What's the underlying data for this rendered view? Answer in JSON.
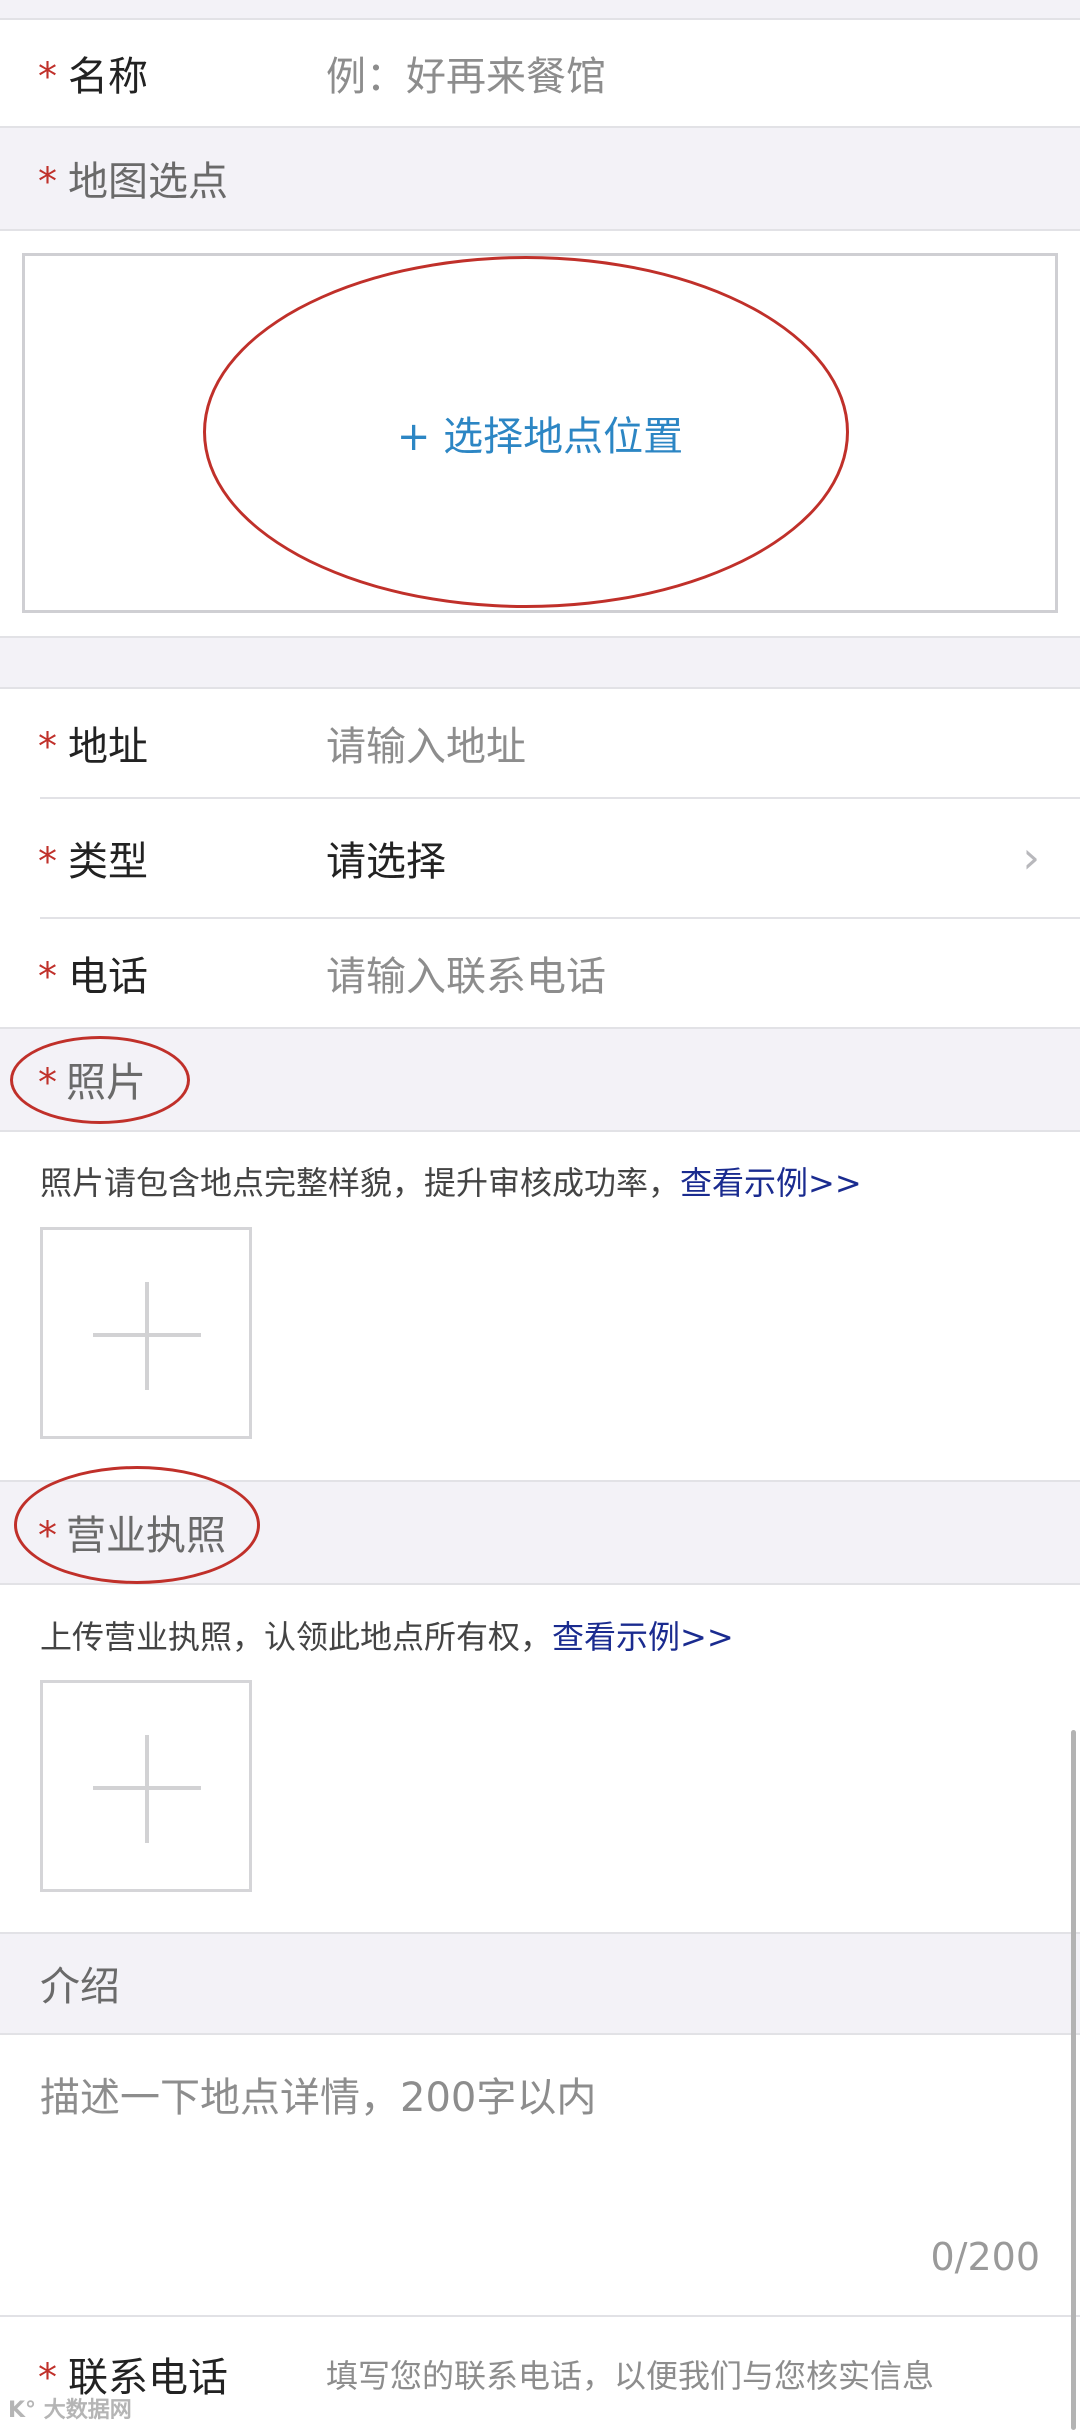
{
  "required_mark": "*",
  "name": {
    "label": "名称",
    "placeholder": "例：好再来餐馆"
  },
  "map_section": {
    "label": "地图选点",
    "button": "+ 选择地点位置"
  },
  "address": {
    "label": "地址",
    "placeholder": "请输入地址"
  },
  "type": {
    "label": "类型",
    "value": "请选择"
  },
  "phone": {
    "label": "电话",
    "placeholder": "请输入联系电话"
  },
  "photos": {
    "label": "照片",
    "hint": "照片请包含地点完整样貌，提升审核成功率，",
    "link": "查看示例>>"
  },
  "license": {
    "label": "营业执照",
    "hint": "上传营业执照，认领此地点所有权，",
    "link": "查看示例>>"
  },
  "intro": {
    "label": "介绍",
    "placeholder": "描述一下地点详情，200字以内",
    "counter": "0/200"
  },
  "contact": {
    "label": "联系电话",
    "placeholder": "填写您的联系电话，以便我们与您核实信息"
  },
  "watermark": "K° 大数据网",
  "colors": {
    "required": "#c0302a",
    "accent": "#2c86c4",
    "link": "#1a2b8f",
    "section_bg": "#f3f2f7"
  }
}
